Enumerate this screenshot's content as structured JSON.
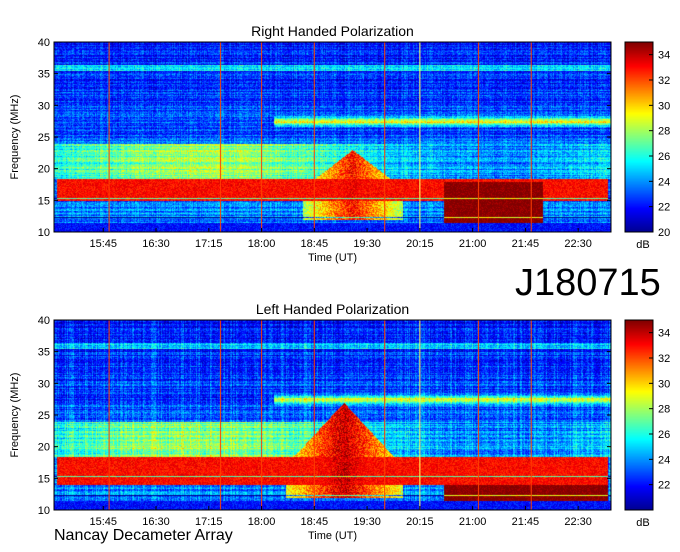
{
  "observation_id": "J180715",
  "credit": "Nancay Decameter Array",
  "colors": {
    "colormap": [
      "#00008f",
      "#0000ff",
      "#0080ff",
      "#00ffff",
      "#80ff80",
      "#ffff00",
      "#ff8000",
      "#ff0000",
      "#800000"
    ],
    "marker_line": "#ff4000",
    "marker_line_alt": "#ffff60"
  },
  "chart_data": [
    {
      "type": "heatmap",
      "title": "Right Handed Polarization",
      "xlabel": "Time (UT)",
      "ylabel": "Frequency (MHz)",
      "x_ticks": [
        "15:45",
        "16:30",
        "17:15",
        "18:00",
        "18:45",
        "19:30",
        "20:15",
        "21:00",
        "21:45",
        "22:30"
      ],
      "y_ticks": [
        10,
        15,
        20,
        25,
        30,
        35,
        40
      ],
      "ylim": [
        10,
        40
      ],
      "colorbar": {
        "label": "dB",
        "ticks": [
          20,
          22,
          24,
          26,
          28,
          30,
          32,
          34
        ],
        "range": [
          20,
          35
        ]
      },
      "features": [
        {
          "name": "strong low band",
          "freq_range": [
            15,
            18.5
          ],
          "time_range": [
            "15:05",
            "22:55"
          ],
          "level_db": 33
        },
        {
          "name": "storm",
          "freq_range": [
            12,
            23
          ],
          "time_range": [
            "18:35",
            "20:00"
          ],
          "level_db": 31
        },
        {
          "name": "saturated block",
          "freq_range": [
            10.5,
            18
          ],
          "time_range": [
            "20:35",
            "22:00"
          ],
          "level_db": 35
        }
      ]
    },
    {
      "type": "heatmap",
      "title": "Left Handed Polarization",
      "xlabel": "Time (UT)",
      "ylabel": "Frequency (MHz)",
      "x_ticks": [
        "15:45",
        "16:30",
        "17:15",
        "18:00",
        "18:45",
        "19:30",
        "20:15",
        "21:00",
        "21:45",
        "22:30"
      ],
      "y_ticks": [
        10,
        15,
        20,
        25,
        30,
        35,
        40
      ],
      "ylim": [
        10,
        40
      ],
      "colorbar": {
        "label": "dB",
        "ticks": [
          22,
          24,
          26,
          28,
          30,
          32,
          34
        ],
        "range": [
          20,
          35
        ]
      },
      "features": [
        {
          "name": "strong low band",
          "freq_range": [
            14,
            18.5
          ],
          "time_range": [
            "15:05",
            "22:55"
          ],
          "level_db": 33
        },
        {
          "name": "storm",
          "freq_range": [
            12,
            27
          ],
          "time_range": [
            "18:20",
            "20:00"
          ],
          "level_db": 32
        },
        {
          "name": "saturated block",
          "freq_range": [
            10.5,
            14
          ],
          "time_range": [
            "20:35",
            "22:55"
          ],
          "level_db": 35
        }
      ]
    }
  ]
}
